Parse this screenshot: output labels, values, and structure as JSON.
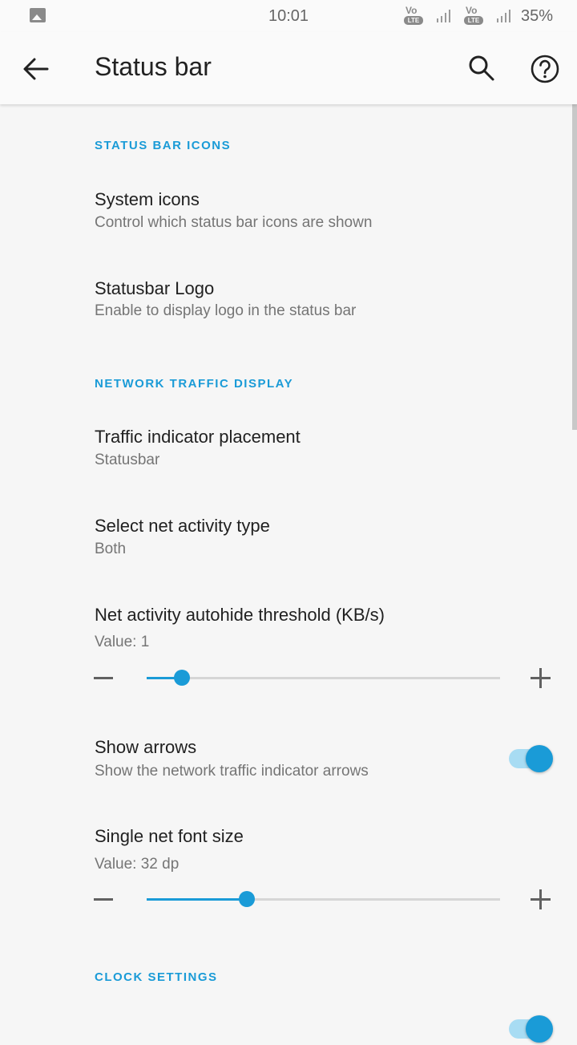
{
  "status_bar": {
    "time": "10:01",
    "battery": "35%",
    "volte_top": "Vo",
    "volte_bottom": "LTE"
  },
  "app_bar": {
    "title": "Status bar"
  },
  "sections": [
    {
      "header": "STATUS BAR ICONS"
    },
    {
      "header": "NETWORK TRAFFIC DISPLAY"
    },
    {
      "header": "CLOCK SETTINGS"
    }
  ],
  "prefs": {
    "system_icons": {
      "title": "System icons",
      "summary": "Control which status bar icons are shown"
    },
    "statusbar_logo": {
      "title": "Statusbar Logo",
      "summary": "Enable to display logo in the status bar"
    },
    "traffic_placement": {
      "title": "Traffic indicator placement",
      "summary": "Statusbar"
    },
    "net_activity_type": {
      "title": "Select net activity type",
      "summary": "Both"
    },
    "autohide_threshold": {
      "title": "Net activity autohide threshold (KB/s)",
      "summary": "Value: 1",
      "fraction": 0.1
    },
    "show_arrows": {
      "title": "Show arrows",
      "summary": "Show the network traffic indicator arrows",
      "checked": true
    },
    "single_font_size": {
      "title": "Single net font size",
      "summary": "Value: 32 dp",
      "fraction": 0.284
    }
  },
  "colors": {
    "accent": "#1a9bd7"
  },
  "icons": {
    "back": "arrow-left-icon",
    "search": "search-icon",
    "help": "help-circle-icon"
  }
}
